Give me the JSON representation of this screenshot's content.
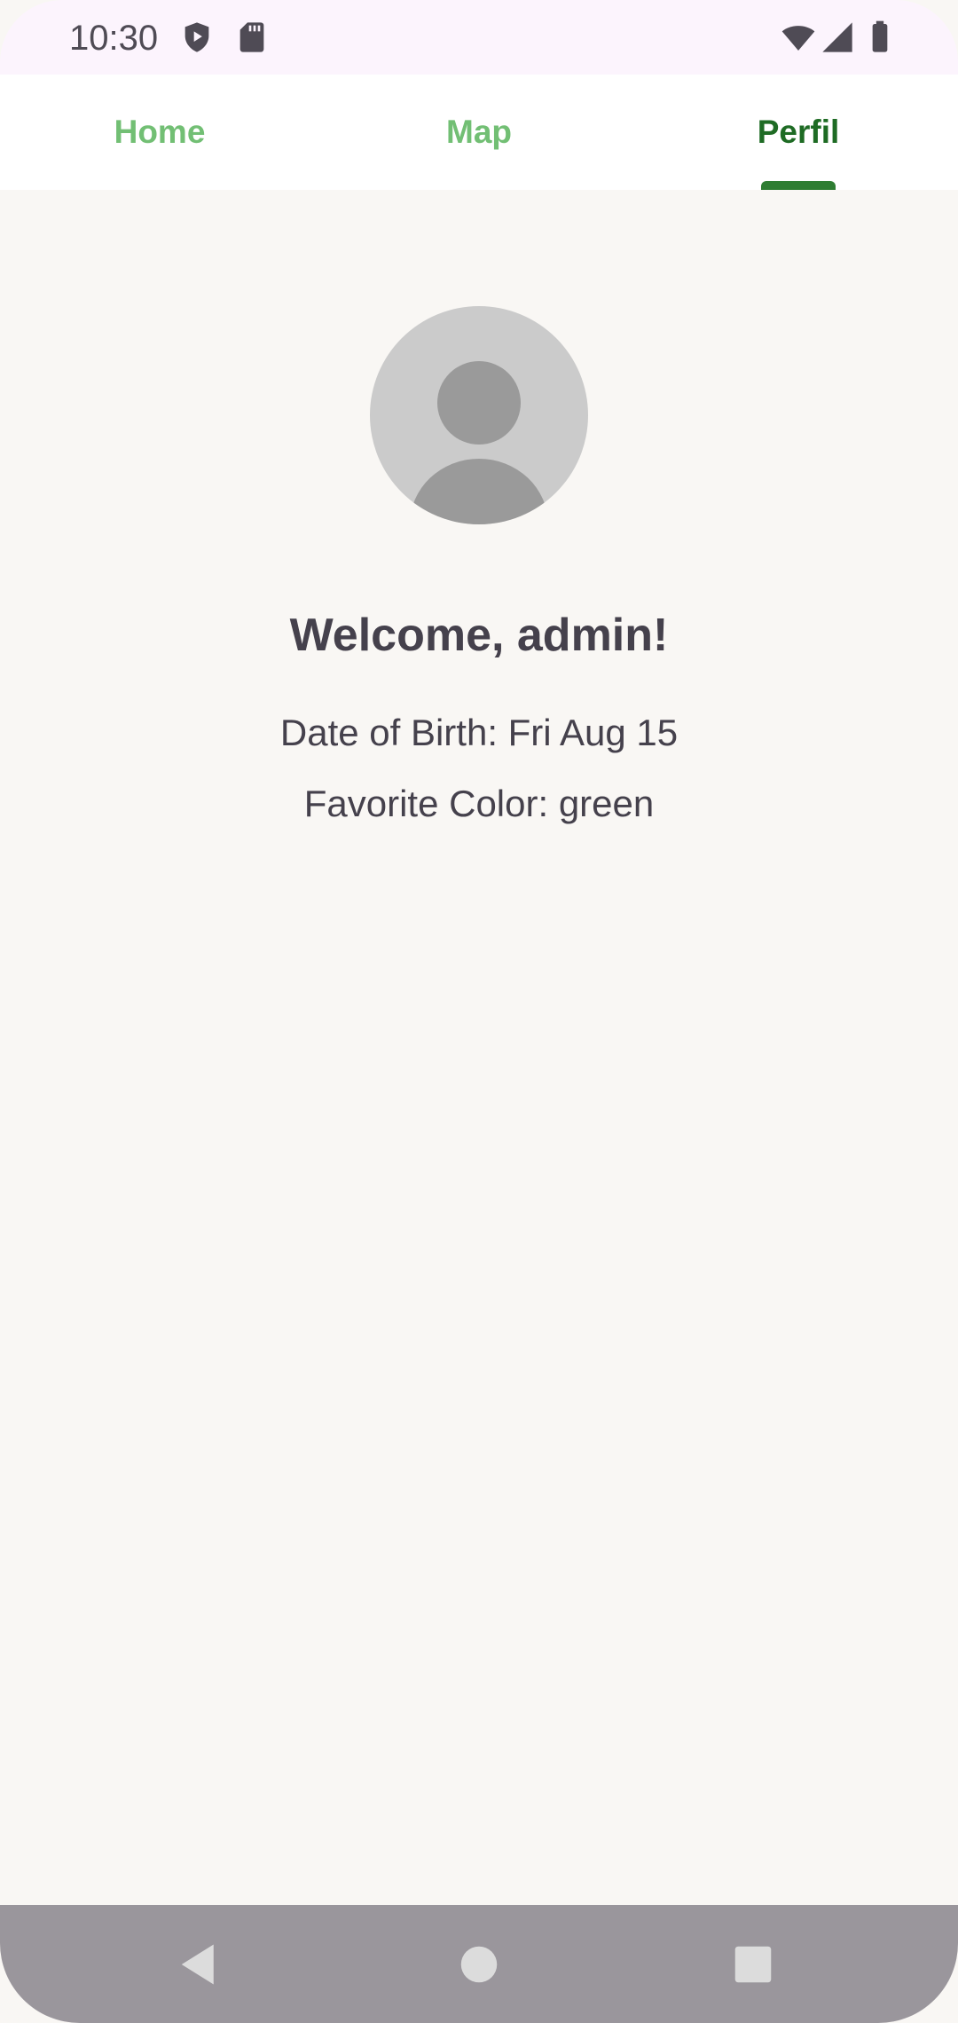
{
  "status_bar": {
    "time": "10:30",
    "icons": [
      "shield-play-icon",
      "sd-card-icon",
      "wifi-icon",
      "cell-signal-icon",
      "battery-icon"
    ]
  },
  "tabs": [
    {
      "label": "Home",
      "active": false
    },
    {
      "label": "Map",
      "active": false
    },
    {
      "label": "Perfil",
      "active": true
    }
  ],
  "profile": {
    "avatar": "person-avatar-icon",
    "welcome": "Welcome, admin!",
    "dob_label": "Date of Birth:",
    "dob_value": "Fri Aug 15",
    "color_label": "Favorite Color:",
    "color_value": "green"
  },
  "nav_bar": {
    "icons": [
      "back-icon",
      "home-icon",
      "recents-icon"
    ]
  },
  "colors": {
    "accent": "#2e7d32",
    "tab_active": "#1e6b24",
    "tab_inactive": "#72bf74",
    "background": "#f9f7f4",
    "status_bar": "#fcf4fd",
    "nav_bar": "#9a969c"
  }
}
